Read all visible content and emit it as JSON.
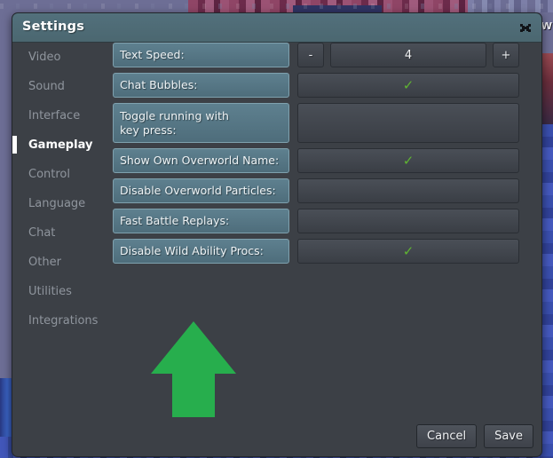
{
  "background": {
    "edge_letter": "w"
  },
  "dialog": {
    "title": "Settings",
    "close_icon": "close-x-icon"
  },
  "sidebar": {
    "items": [
      {
        "label": "Video",
        "active": false
      },
      {
        "label": "Sound",
        "active": false
      },
      {
        "label": "Interface",
        "active": false
      },
      {
        "label": "Gameplay",
        "active": true
      },
      {
        "label": "Control",
        "active": false
      },
      {
        "label": "Language",
        "active": false
      },
      {
        "label": "Chat",
        "active": false
      },
      {
        "label": "Other",
        "active": false
      },
      {
        "label": "Utilities",
        "active": false
      },
      {
        "label": "Integrations",
        "active": false
      }
    ]
  },
  "settings": {
    "rows": [
      {
        "label": "Text Speed:",
        "type": "stepper",
        "decrement_label": "-",
        "increment_label": "+",
        "value": "4",
        "lines": 1
      },
      {
        "label": "Chat Bubbles:",
        "type": "toggle",
        "checked": true,
        "check_glyph": "✓",
        "lines": 1
      },
      {
        "label": "Toggle running with\nkey press:",
        "type": "toggle",
        "checked": false,
        "check_glyph": "✓",
        "lines": 2
      },
      {
        "label": "Show Own Overworld Name:",
        "type": "toggle",
        "checked": true,
        "check_glyph": "✓",
        "lines": 1
      },
      {
        "label": "Disable Overworld Particles:",
        "type": "toggle",
        "checked": false,
        "check_glyph": "✓",
        "lines": 1
      },
      {
        "label": "Fast Battle Replays:",
        "type": "toggle",
        "checked": false,
        "check_glyph": "✓",
        "lines": 1
      },
      {
        "label": "Disable Wild Ability Procs:",
        "type": "toggle",
        "checked": true,
        "check_glyph": "✓",
        "lines": 1
      }
    ]
  },
  "annotation": {
    "arrow_icon": "up-arrow-icon",
    "arrow_color": "#27ae4d"
  },
  "footer": {
    "cancel_label": "Cancel",
    "save_label": "Save"
  },
  "colors": {
    "title_bar": "#4e6c77",
    "dialog_body": "#3c4046",
    "label_panel": "#54737f",
    "control_panel": "#42464e",
    "check_green": "#5fb332",
    "active_nav": "#ffffff",
    "inactive_nav": "#8f959d"
  }
}
